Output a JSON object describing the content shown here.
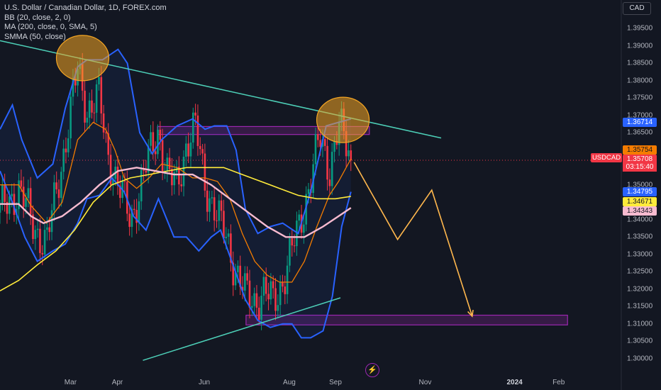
{
  "header": {
    "title": "U.S. Dollar / Canadian Dollar, 1D, FOREX.com",
    "indicators": [
      "BB (20, close, 2, 0)",
      "MA (200, close, 0, SMA, 5)",
      "SMMA (50, close)"
    ]
  },
  "currency_button": "CAD",
  "symbol_tag": "USDCAD",
  "countdown": "03:15:40",
  "price_tags": [
    {
      "text": "1.36714",
      "bg": "#2962ff",
      "fg": "#ffffff",
      "value": 1.36714
    },
    {
      "text": "1.35754",
      "bg": "#f57c00",
      "fg": "#131722",
      "value": 1.35754
    },
    {
      "text": "1.35708",
      "bg": "#f23645",
      "fg": "#ffffff",
      "value": 1.35708
    },
    {
      "text": "1.34795",
      "bg": "#2962ff",
      "fg": "#ffffff",
      "value": 1.34795
    },
    {
      "text": "1.34671",
      "bg": "#ffeb3b",
      "fg": "#131722",
      "value": 1.34671
    },
    {
      "text": "1.34343",
      "bg": "#f8bbd0",
      "fg": "#131722",
      "value": 1.34343
    }
  ],
  "colors": {
    "background": "#131722",
    "up_candle": "#089981",
    "down_candle": "#f23645",
    "bollinger": "#2962ff",
    "sma200": "#ffeb3b",
    "smma50": "#f8bbd0",
    "bb_basis": "#f57c00",
    "trendline": "#4dd0b8",
    "zone": "#9c27b0",
    "projection": "#ffb74d",
    "highlight": "#f5a623"
  },
  "flash_icon": "lightning-icon",
  "chart_data": {
    "type": "candlestick",
    "y_axis_ticks": [
      "1.39500",
      "1.39000",
      "1.38500",
      "1.38000",
      "1.37500",
      "1.37000",
      "1.36500",
      "1.36000",
      "1.35500",
      "1.35000",
      "1.34500",
      "1.34000",
      "1.33500",
      "1.33000",
      "1.32500",
      "1.32000",
      "1.31500",
      "1.31000",
      "1.30500",
      "1.30000"
    ],
    "ylim": [
      1.2975,
      1.3975
    ],
    "x_axis_ticks": [
      {
        "label": "Mar",
        "pos": 0.1135,
        "bold": false
      },
      {
        "label": "Apr",
        "pos": 0.1889,
        "bold": false
      },
      {
        "label": "Jun",
        "pos": 0.3288,
        "bold": false
      },
      {
        "label": "Aug",
        "pos": 0.4657,
        "bold": false
      },
      {
        "label": "Sep",
        "pos": 0.54,
        "bold": false
      },
      {
        "label": "Nov",
        "pos": 0.6843,
        "bold": false
      },
      {
        "label": "2024",
        "pos": 0.8283,
        "bold": true
      },
      {
        "label": "Feb",
        "pos": 0.8992,
        "bold": false
      }
    ],
    "last_price": 1.35708,
    "resistance_zone": {
      "from": 1.3645,
      "to": 1.3668
    },
    "support_zone": {
      "from": 1.3097,
      "to": 1.3125
    },
    "candles": {
      "start": 0.0,
      "end": 0.5648,
      "anchors": [
        [
          0,
          1.342
        ],
        [
          0.03,
          1.349
        ],
        [
          0.055,
          1.338
        ],
        [
          0.075,
          1.333
        ],
        [
          0.1,
          1.357
        ],
        [
          0.125,
          1.383
        ],
        [
          0.14,
          1.372
        ],
        [
          0.16,
          1.375
        ],
        [
          0.17,
          1.362
        ],
        [
          0.19,
          1.35
        ],
        [
          0.21,
          1.34
        ],
        [
          0.235,
          1.355
        ],
        [
          0.255,
          1.366
        ],
        [
          0.27,
          1.352
        ],
        [
          0.285,
          1.35
        ],
        [
          0.3,
          1.362
        ],
        [
          0.315,
          1.366
        ],
        [
          0.33,
          1.351
        ],
        [
          0.35,
          1.34
        ],
        [
          0.365,
          1.335
        ],
        [
          0.38,
          1.325
        ],
        [
          0.395,
          1.318
        ],
        [
          0.41,
          1.317
        ],
        [
          0.425,
          1.319
        ],
        [
          0.44,
          1.316
        ],
        [
          0.46,
          1.325
        ],
        [
          0.48,
          1.337
        ],
        [
          0.5,
          1.352
        ],
        [
          0.515,
          1.363
        ],
        [
          0.53,
          1.355
        ],
        [
          0.545,
          1.367
        ],
        [
          0.5648,
          1.3575
        ]
      ]
    },
    "bollinger_upper": [
      [
        0,
        1.366
      ],
      [
        0.02,
        1.373
      ],
      [
        0.035,
        1.363
      ],
      [
        0.06,
        1.352
      ],
      [
        0.085,
        1.356
      ],
      [
        0.105,
        1.372
      ],
      [
        0.125,
        1.384
      ],
      [
        0.14,
        1.386
      ],
      [
        0.165,
        1.386
      ],
      [
        0.19,
        1.389
      ],
      [
        0.205,
        1.385
      ],
      [
        0.225,
        1.365
      ],
      [
        0.245,
        1.359
      ],
      [
        0.26,
        1.363
      ],
      [
        0.285,
        1.367
      ],
      [
        0.31,
        1.369
      ],
      [
        0.33,
        1.366
      ],
      [
        0.345,
        1.367
      ],
      [
        0.365,
        1.367
      ],
      [
        0.38,
        1.36
      ],
      [
        0.395,
        1.343
      ],
      [
        0.415,
        1.336
      ],
      [
        0.435,
        1.338
      ],
      [
        0.455,
        1.339
      ],
      [
        0.48,
        1.336
      ],
      [
        0.5,
        1.348
      ],
      [
        0.525,
        1.367
      ],
      [
        0.545,
        1.368
      ],
      [
        0.5648,
        1.369
      ]
    ],
    "bollinger_lower": [
      [
        0,
        1.354
      ],
      [
        0.02,
        1.345
      ],
      [
        0.04,
        1.335
      ],
      [
        0.06,
        1.328
      ],
      [
        0.085,
        1.331
      ],
      [
        0.105,
        1.333
      ],
      [
        0.125,
        1.339
      ],
      [
        0.14,
        1.346
      ],
      [
        0.16,
        1.347
      ],
      [
        0.18,
        1.352
      ],
      [
        0.2,
        1.348
      ],
      [
        0.215,
        1.341
      ],
      [
        0.235,
        1.337
      ],
      [
        0.255,
        1.346
      ],
      [
        0.28,
        1.335
      ],
      [
        0.3,
        1.335
      ],
      [
        0.32,
        1.331
      ],
      [
        0.34,
        1.335
      ],
      [
        0.355,
        1.337
      ],
      [
        0.375,
        1.327
      ],
      [
        0.395,
        1.317
      ],
      [
        0.415,
        1.311
      ],
      [
        0.435,
        1.309
      ],
      [
        0.455,
        1.31
      ],
      [
        0.47,
        1.31
      ],
      [
        0.485,
        1.306
      ],
      [
        0.5,
        1.306
      ],
      [
        0.52,
        1.308
      ],
      [
        0.535,
        1.318
      ],
      [
        0.55,
        1.338
      ],
      [
        0.5648,
        1.348
      ]
    ],
    "bb_basis": [
      [
        0,
        1.35
      ],
      [
        0.03,
        1.35
      ],
      [
        0.05,
        1.344
      ],
      [
        0.075,
        1.339
      ],
      [
        0.1,
        1.345
      ],
      [
        0.125,
        1.363
      ],
      [
        0.15,
        1.368
      ],
      [
        0.17,
        1.366
      ],
      [
        0.185,
        1.36
      ],
      [
        0.2,
        1.352
      ],
      [
        0.22,
        1.349
      ],
      [
        0.24,
        1.352
      ],
      [
        0.26,
        1.356
      ],
      [
        0.285,
        1.355
      ],
      [
        0.31,
        1.352
      ],
      [
        0.33,
        1.352
      ],
      [
        0.35,
        1.351
      ],
      [
        0.37,
        1.346
      ],
      [
        0.39,
        1.336
      ],
      [
        0.41,
        1.328
      ],
      [
        0.43,
        1.324
      ],
      [
        0.45,
        1.322
      ],
      [
        0.47,
        1.322
      ],
      [
        0.49,
        1.328
      ],
      [
        0.51,
        1.338
      ],
      [
        0.53,
        1.347
      ],
      [
        0.545,
        1.351
      ],
      [
        0.5648,
        1.3575
      ]
    ],
    "sma200": [
      [
        0,
        1.3195
      ],
      [
        0.03,
        1.3225
      ],
      [
        0.06,
        1.327
      ],
      [
        0.09,
        1.331
      ],
      [
        0.12,
        1.337
      ],
      [
        0.15,
        1.345
      ],
      [
        0.18,
        1.35
      ],
      [
        0.21,
        1.352
      ],
      [
        0.24,
        1.353
      ],
      [
        0.27,
        1.354
      ],
      [
        0.3,
        1.355
      ],
      [
        0.33,
        1.355
      ],
      [
        0.36,
        1.355
      ],
      [
        0.39,
        1.353
      ],
      [
        0.42,
        1.351
      ],
      [
        0.45,
        1.349
      ],
      [
        0.48,
        1.347
      ],
      [
        0.51,
        1.346
      ],
      [
        0.54,
        1.346
      ],
      [
        0.5648,
        1.3467
      ]
    ],
    "smma50": [
      [
        0,
        1.3445
      ],
      [
        0.03,
        1.3445
      ],
      [
        0.05,
        1.341
      ],
      [
        0.07,
        1.339
      ],
      [
        0.1,
        1.341
      ],
      [
        0.13,
        1.345
      ],
      [
        0.16,
        1.35
      ],
      [
        0.19,
        1.354
      ],
      [
        0.22,
        1.355
      ],
      [
        0.25,
        1.354
      ],
      [
        0.28,
        1.353
      ],
      [
        0.31,
        1.353
      ],
      [
        0.34,
        1.35
      ],
      [
        0.37,
        1.346
      ],
      [
        0.4,
        1.342
      ],
      [
        0.43,
        1.338
      ],
      [
        0.46,
        1.335
      ],
      [
        0.49,
        1.335
      ],
      [
        0.52,
        1.338
      ],
      [
        0.545,
        1.341
      ],
      [
        0.5648,
        1.3434
      ]
    ],
    "trendline_top": [
      [
        0,
        1.3915
      ],
      [
        0.71,
        1.3635
      ]
    ],
    "trendline_bottom": [
      [
        0.23,
        1.2995
      ],
      [
        0.548,
        1.3175
      ]
    ],
    "projection_path": [
      [
        0.57,
        1.3565
      ],
      [
        0.64,
        1.3343
      ],
      [
        0.695,
        1.3485
      ],
      [
        0.76,
        1.3122
      ]
    ],
    "highlight_circles": [
      [
        0.133,
        1.3865
      ],
      [
        0.552,
        1.3687
      ]
    ]
  }
}
